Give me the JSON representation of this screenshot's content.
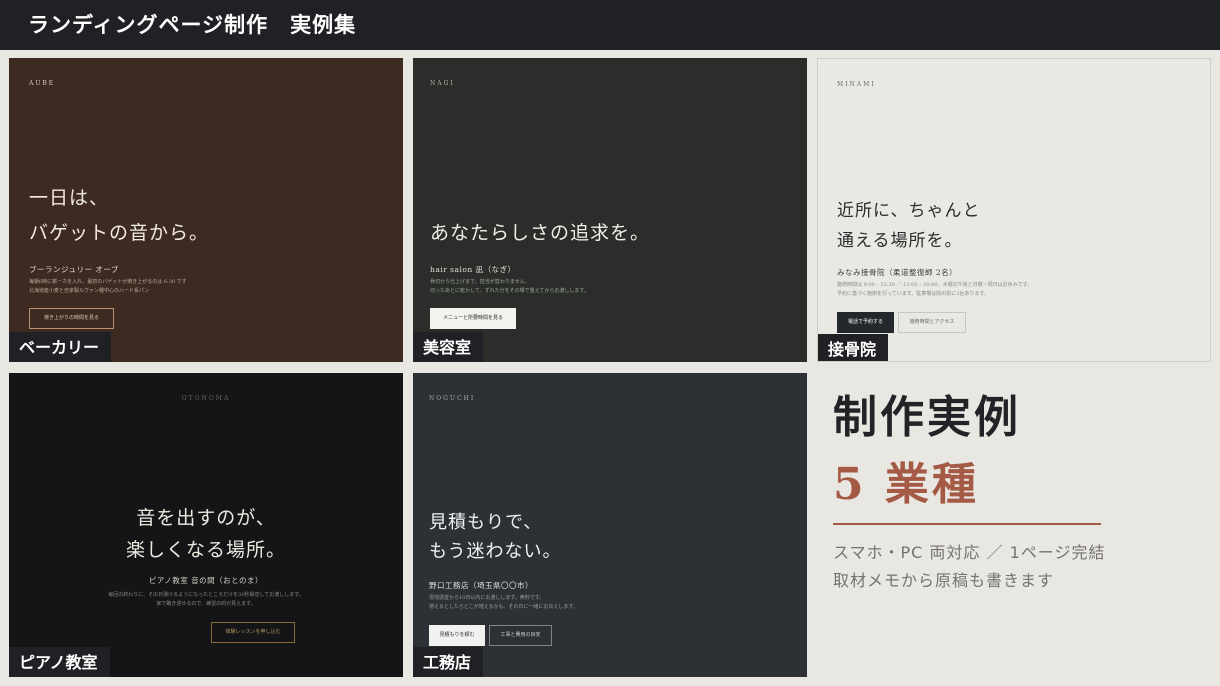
{
  "header": {
    "title": "ランディングページ制作　実例集"
  },
  "cards": [
    {
      "brand": "AUBE",
      "headline_1": "一日は、",
      "headline_2": "バゲットの音から。",
      "subname": "ブーランジュリー オーブ",
      "desc_1": "毎朝6時に薪ーカを入れ、最初のバゲットが焼き上がるのは 6:30 です",
      "desc_2": "北海道産小麦と自家製ルヴァン種中心のハード系パン",
      "button": "焼き上がりの時間を見る",
      "tag": "ベーカリー"
    },
    {
      "brand": "NAGI",
      "headline_1": "あなたらしさの追求を。",
      "subname": "hair salon 凪（なぎ）",
      "desc_1": "骨切から仕上げまで、担当が替わりません。",
      "desc_2": "切ったあとに乾かして、ずれた分をその場で整えてからお渡しします。",
      "button": "メニューと所要時間を見る",
      "tag": "美容室"
    },
    {
      "brand": "MINAMI",
      "headline_1": "近所に、ちゃんと",
      "headline_2": "通える場所を。",
      "subname": "みなみ接骨院（柔道整復師 2名）",
      "desc_1": "施術時間は 9:00 – 12:30 ／ 15:00 – 20:00。木曜の午後と日曜・祝日はお休みです。",
      "desc_2": "予約に基づく施術を行っています。駐車場は院の前に3台あります。",
      "button_1": "電話で予約する",
      "button_2": "施術時間とアクセス",
      "tag": "接骨院"
    },
    {
      "brand": "OTONOMA",
      "headline_1": "音を出すのが、",
      "headline_2": "楽しくなる場所。",
      "subname": "ピアノ教室 音の間（おとのま）",
      "desc_1": "毎回の終わりに、その日弾けるようになったところだけを30秒録音してお渡しします。",
      "desc_2": "家で聴き返せるので、練習の的が見えます。",
      "button": "体験レッスンを申し込む",
      "tag": "ピアノ教室"
    },
    {
      "brand": "NOGUCHI",
      "headline_1": "見積もりで、",
      "headline_2": "もう迷わない。",
      "subname": "野口工務店（埼玉県〇〇市）",
      "desc_1": "現地調査から10日以内にお渡しします。無料です。",
      "desc_2": "増えるとしたらどこが増えるかも、その日に一緒にお伝えします。",
      "button_1": "見積もりを頼む",
      "button_2": "工事と費用の目安",
      "tag": "工務店"
    }
  ],
  "summary": {
    "title": "制作実例",
    "count": "5 業種",
    "line_1": "スマホ・PC 両対応 ／ 1ページ完結",
    "line_2": "取材メモから原稿も書きます"
  },
  "colors": {
    "dark_bar": "#1f2125",
    "accent": "#a55a45",
    "background": "#e9e7e2"
  }
}
